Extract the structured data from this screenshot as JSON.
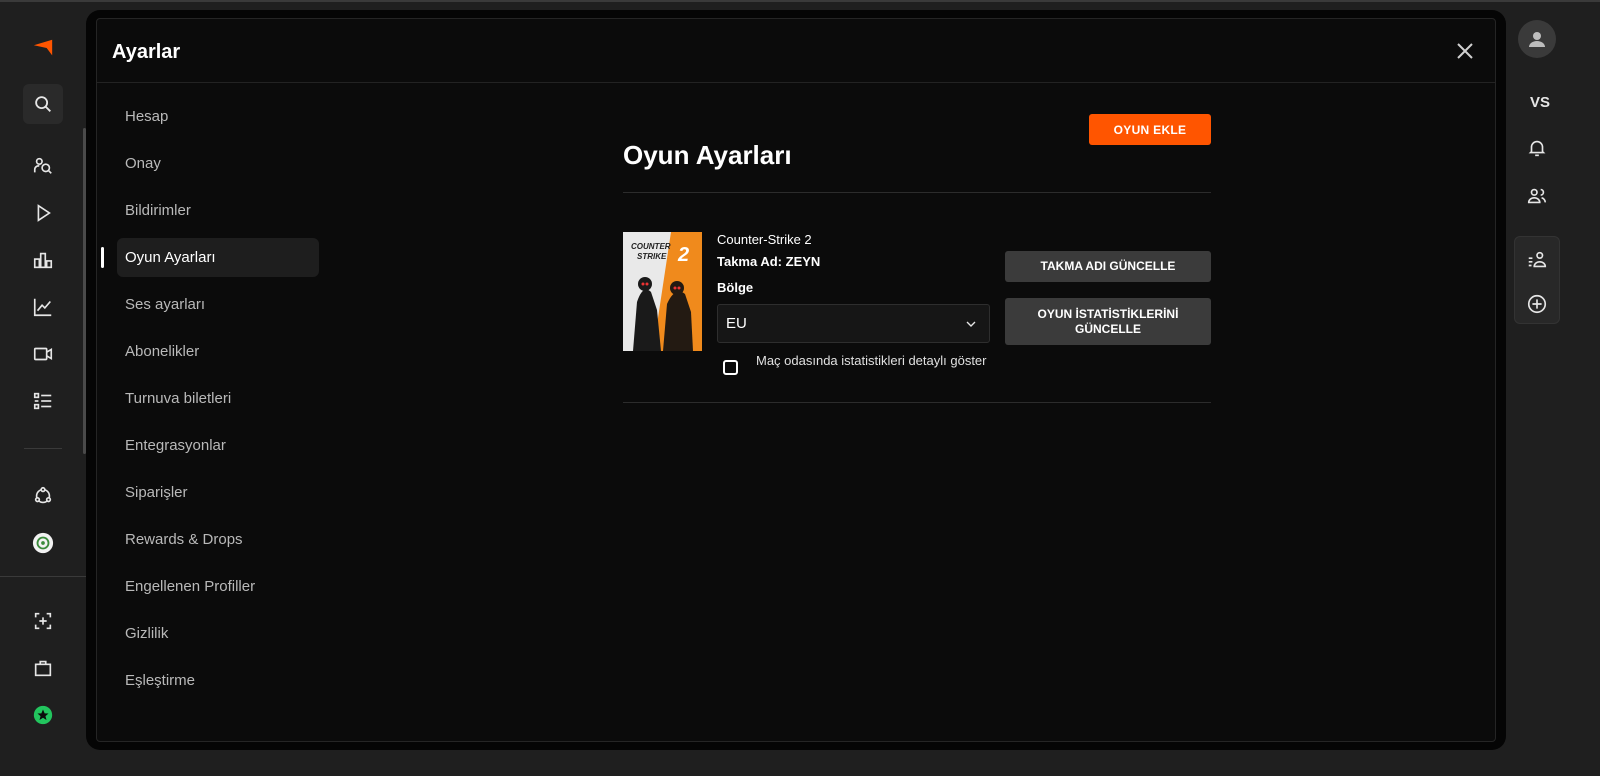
{
  "modal": {
    "title": "Ayarlar"
  },
  "nav": {
    "items": [
      {
        "label": "Hesap"
      },
      {
        "label": "Onay"
      },
      {
        "label": "Bildirimler"
      },
      {
        "label": "Oyun Ayarları",
        "active": true
      },
      {
        "label": "Ses ayarları"
      },
      {
        "label": "Abonelikler"
      },
      {
        "label": "Turnuva biletleri"
      },
      {
        "label": "Entegrasyonlar"
      },
      {
        "label": "Siparişler"
      },
      {
        "label": "Rewards & Drops"
      },
      {
        "label": "Engellenen Profiller"
      },
      {
        "label": "Gizlilik"
      },
      {
        "label": "Eşleştirme"
      }
    ]
  },
  "content": {
    "title": "Oyun Ayarları",
    "add_game_label": "OYUN EKLE",
    "game": {
      "name": "Counter-Strike 2",
      "nickname": "Takma Ad: ZEYN",
      "region_label": "Bölge",
      "region_value": "EU",
      "detailed_stats_label": "Maç odasında istatistikleri detaylı göster",
      "detailed_stats_checked": false,
      "cover_title_line1": "COUNTER",
      "cover_title_line2": "STRIKE",
      "cover_number": "2",
      "update_nick_label": "TAKMA ADI GÜNCELLE",
      "update_stats_label": "OYUN İSTATİSTİKLERİNİ GÜNCELLE"
    }
  },
  "right_rail": {
    "vs_label": "VS"
  },
  "colors": {
    "accent": "#ff5500",
    "background": "#0b0b0b",
    "rail": "#1f1f1f",
    "button_gray": "#3b3b3b"
  },
  "icons": {
    "left_rail": [
      "faceit-logo-icon",
      "search-icon",
      "find-players-icon",
      "play-icon",
      "leaderboard-icon",
      "stats-icon",
      "video-icon",
      "list-icon",
      "hub-icon",
      "club-avatar-icon",
      "scan-plus-icon",
      "briefcase-icon",
      "green-star-icon"
    ],
    "right_rail": [
      "user-avatar-icon",
      "bell-icon",
      "friends-icon",
      "party-icon",
      "add-circle-icon"
    ]
  }
}
